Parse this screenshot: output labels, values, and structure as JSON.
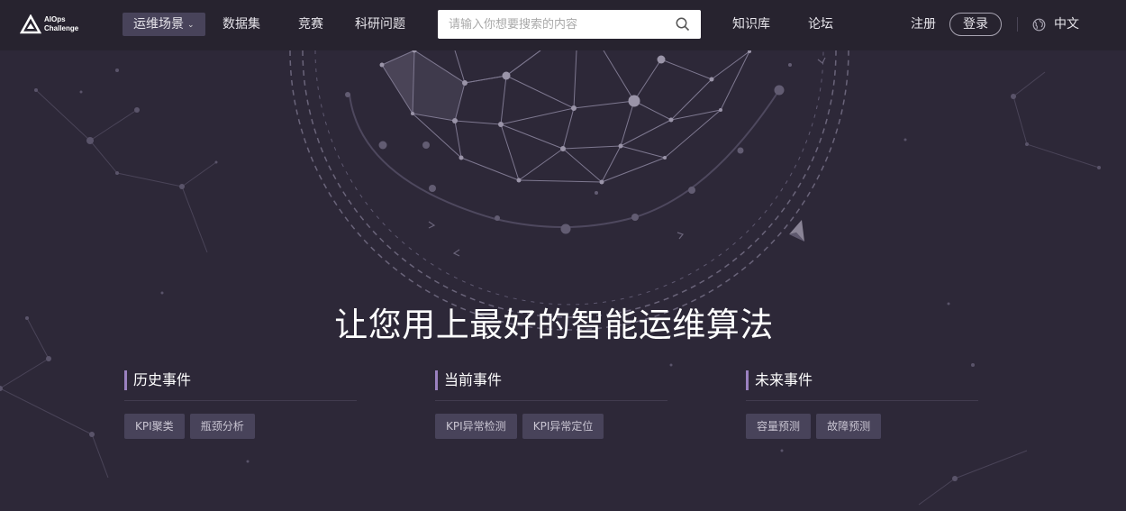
{
  "logo": {
    "line1": "AIOps",
    "line2": "Challenge",
    "icon": "triangle-logo-icon"
  },
  "nav": {
    "items": [
      {
        "label": "运维场景",
        "active": true
      },
      {
        "label": "数据集"
      },
      {
        "label": "竞赛"
      },
      {
        "label": "科研问题"
      }
    ],
    "search_placeholder": "请输入你想要搜索的内容",
    "right_items": [
      {
        "label": "知识库"
      },
      {
        "label": "论坛"
      }
    ],
    "register": "注册",
    "login": "登录",
    "language": "中文"
  },
  "hero": {
    "title": "让您用上最好的智能运维算法"
  },
  "sections": [
    {
      "title": "历史事件",
      "tags": [
        "KPI聚类",
        "瓶颈分析"
      ]
    },
    {
      "title": "当前事件",
      "tags": [
        "KPI异常检测",
        "KPI异常定位"
      ]
    },
    {
      "title": "未来事件",
      "tags": [
        "容量预测",
        "故障预测"
      ]
    }
  ],
  "colors": {
    "background": "#2d2838",
    "nav_bg": "#27232f",
    "accent": "#9b81c0",
    "tag_bg": "#48435a"
  }
}
